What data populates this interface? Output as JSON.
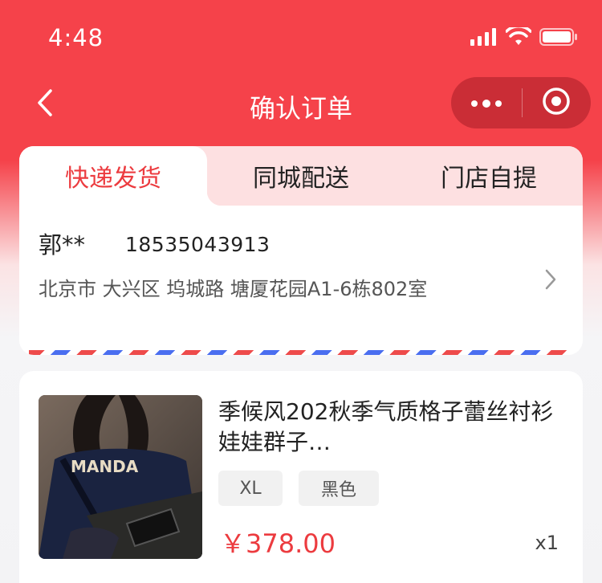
{
  "status_bar": {
    "time": "4:48",
    "icons": [
      "signal-icon",
      "wifi-icon",
      "battery-icon"
    ]
  },
  "nav": {
    "title": "确认订单",
    "back_icon": "chevron-left-icon",
    "menu_icon": "more-dots-icon",
    "close_icon": "target-circle-icon"
  },
  "delivery_tabs": [
    {
      "label": "快递发货",
      "active": true
    },
    {
      "label": "同城配送",
      "active": false
    },
    {
      "label": "门店自提",
      "active": false
    }
  ],
  "address": {
    "name": "郭**",
    "phone": "18535043913",
    "detail": "北京市 大兴区 坞城路 塘厦花园A1-6栋802室"
  },
  "product": {
    "title": "季候风202秋季气质格子蕾丝衬衫娃娃群子…",
    "specs": [
      "XL",
      "黑色"
    ],
    "price": "￥378.00",
    "quantity": "x1",
    "image_label": "MANDA"
  },
  "colors": {
    "accent": "#ec3b3f",
    "header": "#f5424a",
    "tab_inactive_bg": "#fde0e1"
  }
}
